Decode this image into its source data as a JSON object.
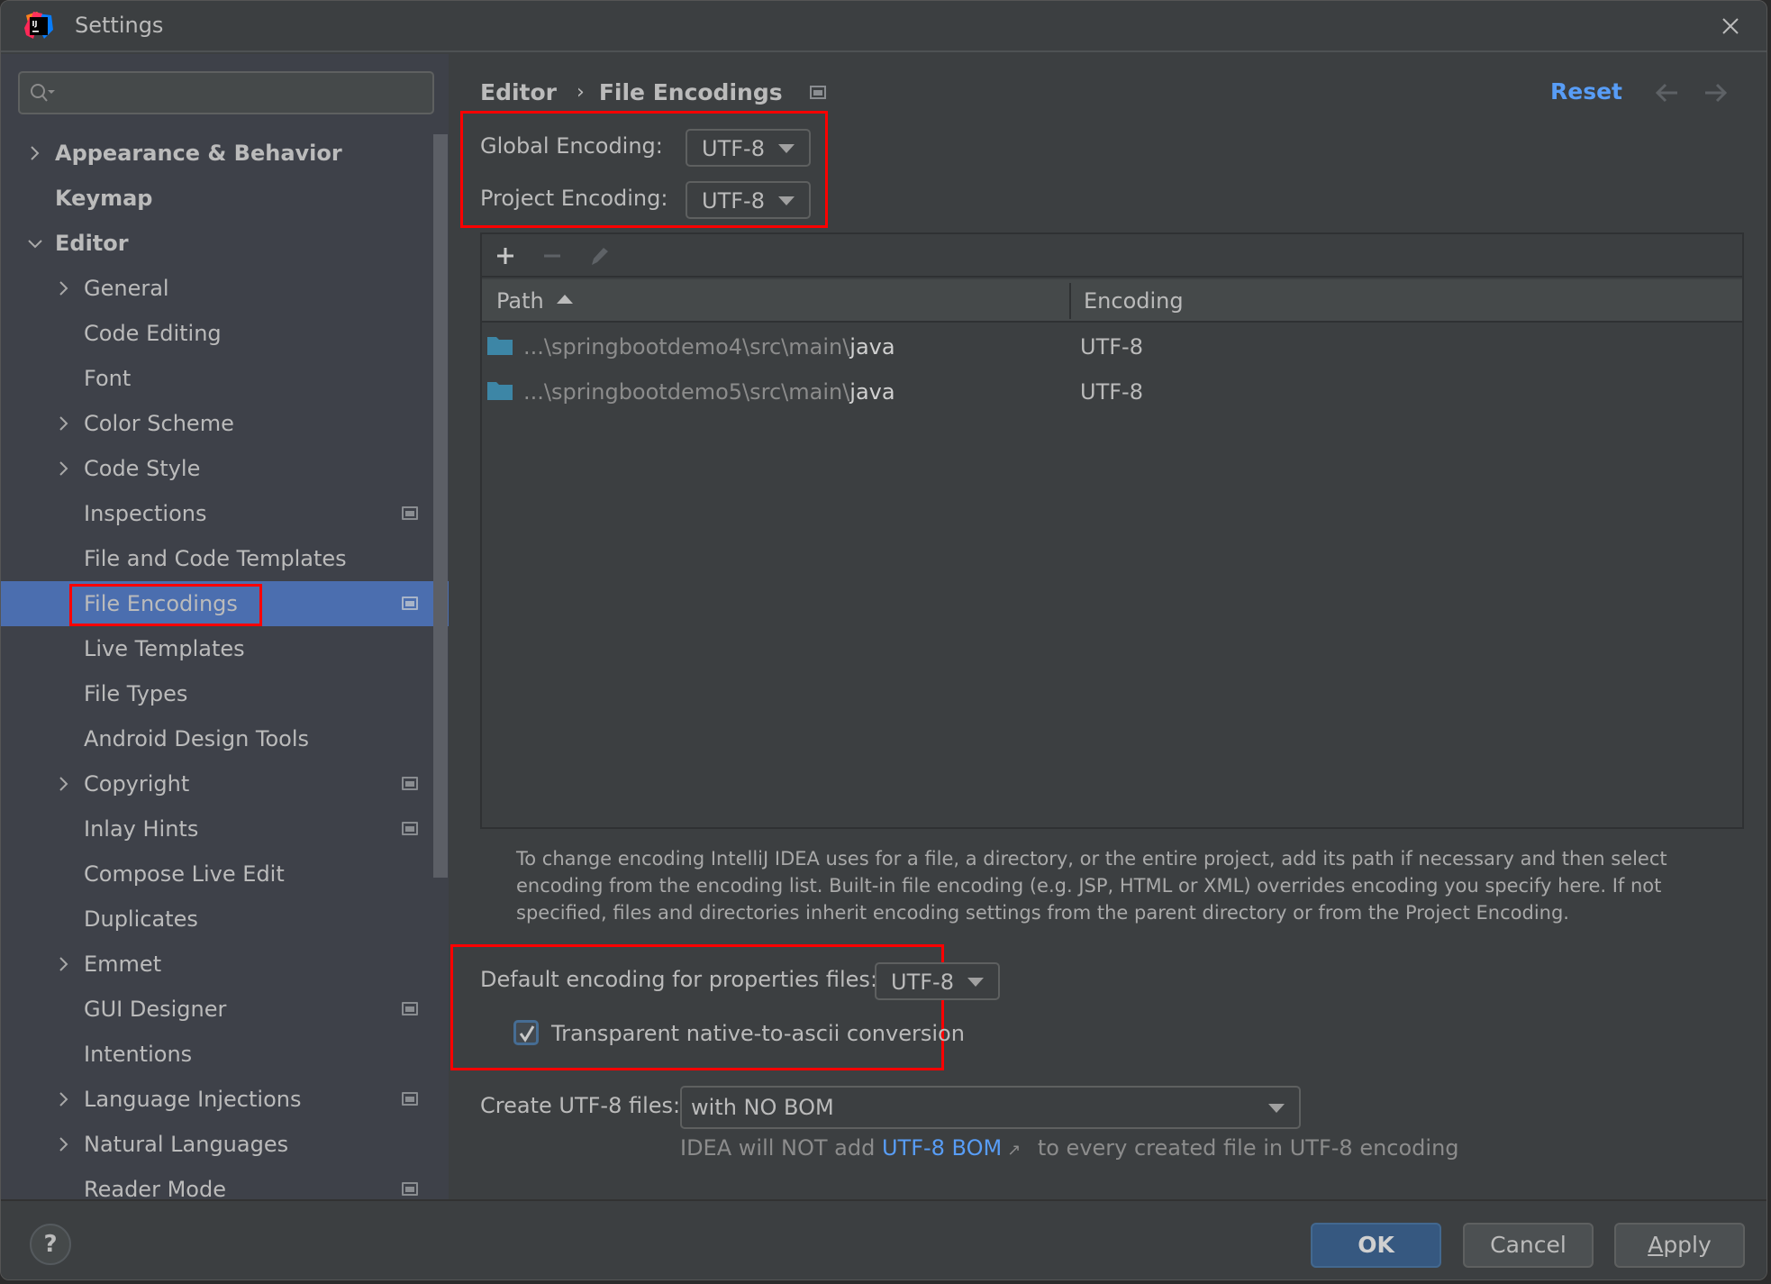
{
  "window": {
    "title": "Settings",
    "app_logo": "intellij-idea-logo",
    "close_icon": "close-icon"
  },
  "search": {
    "placeholder": "",
    "value": ""
  },
  "sidebar": {
    "items": [
      {
        "label": "Appearance & Behavior",
        "level": 0,
        "expandable": true,
        "expanded": false,
        "bold": true,
        "project_scope": false
      },
      {
        "label": "Keymap",
        "level": 0,
        "expandable": false,
        "bold": true,
        "project_scope": false
      },
      {
        "label": "Editor",
        "level": 0,
        "expandable": true,
        "expanded": true,
        "bold": true,
        "project_scope": false
      },
      {
        "label": "General",
        "level": 1,
        "expandable": true,
        "expanded": false,
        "project_scope": false
      },
      {
        "label": "Code Editing",
        "level": 1,
        "expandable": false,
        "project_scope": false
      },
      {
        "label": "Font",
        "level": 1,
        "expandable": false,
        "project_scope": false
      },
      {
        "label": "Color Scheme",
        "level": 1,
        "expandable": true,
        "expanded": false,
        "project_scope": false
      },
      {
        "label": "Code Style",
        "level": 1,
        "expandable": true,
        "expanded": false,
        "project_scope": false
      },
      {
        "label": "Inspections",
        "level": 1,
        "expandable": false,
        "project_scope": true
      },
      {
        "label": "File and Code Templates",
        "level": 1,
        "expandable": false,
        "project_scope": false
      },
      {
        "label": "File Encodings",
        "level": 1,
        "expandable": false,
        "project_scope": true,
        "selected": true
      },
      {
        "label": "Live Templates",
        "level": 1,
        "expandable": false,
        "project_scope": false
      },
      {
        "label": "File Types",
        "level": 1,
        "expandable": false,
        "project_scope": false
      },
      {
        "label": "Android Design Tools",
        "level": 1,
        "expandable": false,
        "project_scope": false
      },
      {
        "label": "Copyright",
        "level": 1,
        "expandable": true,
        "expanded": false,
        "project_scope": true
      },
      {
        "label": "Inlay Hints",
        "level": 1,
        "expandable": false,
        "project_scope": true
      },
      {
        "label": "Compose Live Edit",
        "level": 1,
        "expandable": false,
        "project_scope": false
      },
      {
        "label": "Duplicates",
        "level": 1,
        "expandable": false,
        "project_scope": false
      },
      {
        "label": "Emmet",
        "level": 1,
        "expandable": true,
        "expanded": false,
        "project_scope": false
      },
      {
        "label": "GUI Designer",
        "level": 1,
        "expandable": false,
        "project_scope": true
      },
      {
        "label": "Intentions",
        "level": 1,
        "expandable": false,
        "project_scope": false
      },
      {
        "label": "Language Injections",
        "level": 1,
        "expandable": true,
        "expanded": false,
        "project_scope": true
      },
      {
        "label": "Natural Languages",
        "level": 1,
        "expandable": true,
        "expanded": false,
        "project_scope": false
      },
      {
        "label": "Reader Mode",
        "level": 1,
        "expandable": false,
        "project_scope": true
      }
    ]
  },
  "main": {
    "breadcrumb": {
      "parent": "Editor",
      "separator": "›",
      "current": "File Encodings"
    },
    "reset_label": "Reset",
    "global_encoding": {
      "label": "Global Encoding:",
      "value": "UTF-8"
    },
    "project_encoding": {
      "label": "Project Encoding:",
      "value": "UTF-8"
    },
    "table": {
      "toolbar": {
        "add": "add-icon",
        "remove": "remove-icon",
        "edit": "edit-icon"
      },
      "columns": [
        {
          "label": "Path",
          "sort": "ascending"
        },
        {
          "label": "Encoding"
        }
      ],
      "rows": [
        {
          "path_prefix": "...\\springbootdemo4\\src\\main\\",
          "path_name": "java",
          "encoding": "UTF-8"
        },
        {
          "path_prefix": "...\\springbootdemo5\\src\\main\\",
          "path_name": "java",
          "encoding": "UTF-8"
        }
      ]
    },
    "help_text": "To change encoding IntelliJ IDEA uses for a file, a directory, or the entire project, add its path if necessary and then select encoding from the encoding list. Built-in file encoding (e.g. JSP, HTML or XML) overrides encoding you specify here. If not specified, files and directories inherit encoding settings from the parent directory or from the Project Encoding.",
    "properties_encoding": {
      "label": "Default encoding for properties files:",
      "value": "UTF-8"
    },
    "native_to_ascii": {
      "label": "Transparent native-to-ascii conversion",
      "checked": true
    },
    "create_utf8": {
      "label": "Create UTF-8 files:",
      "value": "with NO BOM"
    },
    "bom_hint": {
      "prefix": "IDEA will NOT add ",
      "link": "UTF-8 BOM",
      "ext": "↗",
      "suffix": " to every created file in UTF-8 encoding"
    }
  },
  "footer": {
    "help": "?",
    "ok": "OK",
    "cancel": "Cancel",
    "apply_mnemonic": "A",
    "apply_rest": "pply"
  },
  "colors": {
    "accent_link": "#589df6",
    "selection": "#4b6eaf",
    "highlight_box": "#ff0000",
    "ok_button": "#365880",
    "folder": "#3d86a6"
  }
}
